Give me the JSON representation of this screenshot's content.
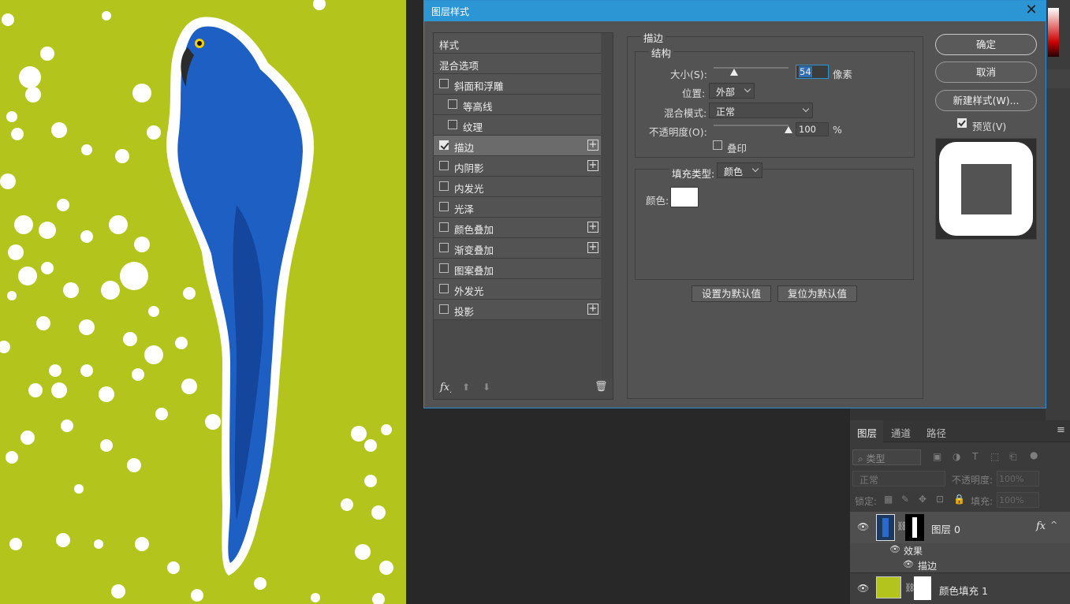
{
  "dialog": {
    "title": "图层样式",
    "styles_header": "样式",
    "blend_options": "混合选项",
    "style_items": [
      {
        "label": "斜面和浮雕",
        "checked": false,
        "indent": false,
        "plus": false
      },
      {
        "label": "等高线",
        "checked": false,
        "indent": true,
        "plus": false
      },
      {
        "label": "纹理",
        "checked": false,
        "indent": true,
        "plus": false
      },
      {
        "label": "描边",
        "checked": true,
        "indent": false,
        "plus": true,
        "selected": true
      },
      {
        "label": "内阴影",
        "checked": false,
        "indent": false,
        "plus": true
      },
      {
        "label": "内发光",
        "checked": false,
        "indent": false,
        "plus": false
      },
      {
        "label": "光泽",
        "checked": false,
        "indent": false,
        "plus": false
      },
      {
        "label": "颜色叠加",
        "checked": false,
        "indent": false,
        "plus": true
      },
      {
        "label": "渐变叠加",
        "checked": false,
        "indent": false,
        "plus": true
      },
      {
        "label": "图案叠加",
        "checked": false,
        "indent": false,
        "plus": false
      },
      {
        "label": "外发光",
        "checked": false,
        "indent": false,
        "plus": false
      },
      {
        "label": "投影",
        "checked": false,
        "indent": false,
        "plus": true
      }
    ],
    "footer": {
      "fx": "fx",
      "fx_sub": "."
    },
    "stroke": {
      "section_title": "描边",
      "structure_title": "结构",
      "size_label": "大小(S):",
      "size_value": "54",
      "size_unit": "像素",
      "size_slider": 0.27,
      "position_label": "位置:",
      "position_value": "外部",
      "blend_label": "混合模式:",
      "blend_value": "正常",
      "opacity_label": "不透明度(O):",
      "opacity_value": "100",
      "opacity_unit": "%",
      "opacity_slider": 1.0,
      "overprint_label": "叠印",
      "overprint_checked": false,
      "fill_type_label": "填充类型:",
      "fill_type_value": "颜色",
      "color_label": "颜色:",
      "color_value": "#ffffff",
      "set_default": "设置为默认值",
      "reset_default": "复位为默认值"
    },
    "buttons": {
      "ok": "确定",
      "cancel": "取消",
      "new_style": "新建样式(W)...",
      "preview_label": "预览(V)",
      "preview_checked": true
    }
  },
  "layers_panel": {
    "tabs": [
      "图层",
      "通道",
      "路径"
    ],
    "active_tab": "图层",
    "filter_label": "类型",
    "blend_mode": "正常",
    "opacity_label": "不透明度:",
    "opacity_value": "100%",
    "lock_label": "锁定:",
    "fill_label": "填充:",
    "fill_value": "100%",
    "layers": [
      {
        "name": "图层 0",
        "fx": "fx",
        "effects_label": "效果",
        "effect": "描边"
      },
      {
        "name": "颜色填充 1",
        "swatch": "#b3c51c"
      }
    ]
  },
  "colors": {
    "canvas_bg": "#b3c51c",
    "parrot": "#1e5fc4",
    "accent": "#2b96d3"
  }
}
